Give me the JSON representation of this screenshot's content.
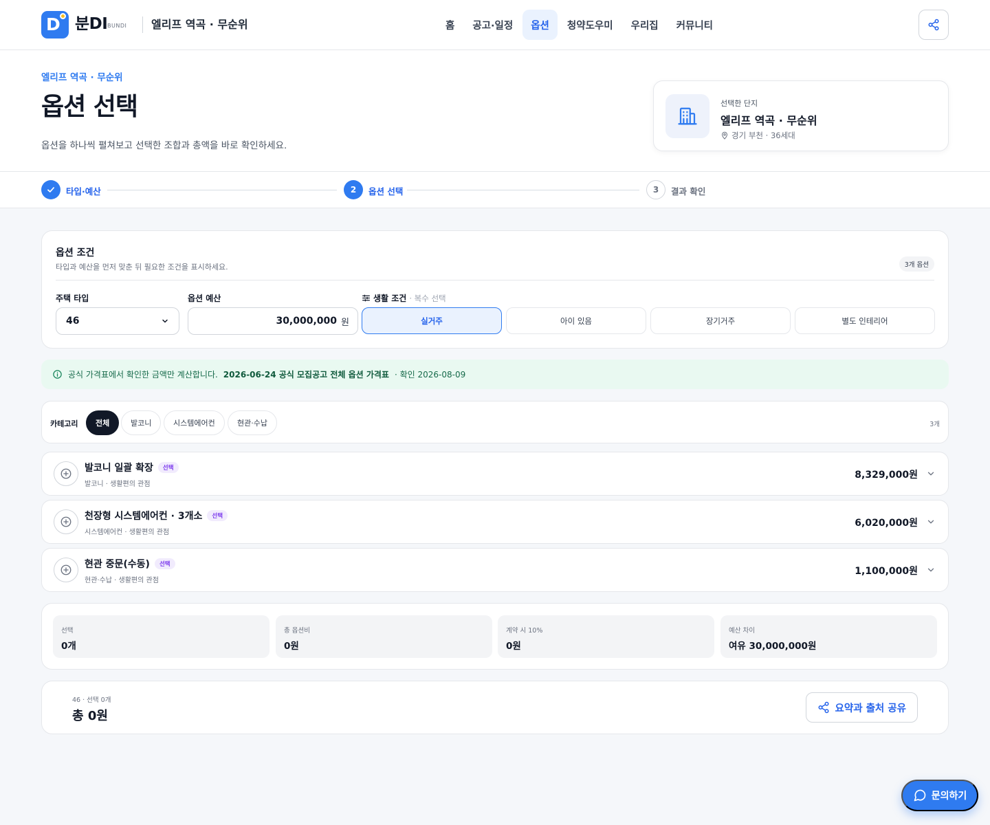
{
  "header": {
    "brand": "분DI",
    "brand_sub": "BUNDI",
    "site_name": "엘리프 역곡 · 무순위",
    "nav": [
      {
        "label": "홈",
        "active": false
      },
      {
        "label": "공고·일정",
        "active": false
      },
      {
        "label": "옵션",
        "active": true
      },
      {
        "label": "청약도우미",
        "active": false
      },
      {
        "label": "우리집",
        "active": false
      },
      {
        "label": "커뮤니티",
        "active": false
      }
    ]
  },
  "hero": {
    "eyebrow": "엘리프 역곡 · 무순위",
    "title": "옵션 선택",
    "description": "옵션을 하나씩 펼쳐보고 선택한 조합과 총액을 바로 확인하세요.",
    "complex_card": {
      "label": "선택한 단지",
      "name": "엘리프 역곡 · 무순위",
      "meta": "경기 부천 · 36세대"
    }
  },
  "stepper": {
    "steps": [
      {
        "number": "1",
        "label": "타입·예산",
        "state": "done"
      },
      {
        "number": "2",
        "label": "옵션 선택",
        "state": "current"
      },
      {
        "number": "3",
        "label": "결과 확인",
        "state": "todo"
      }
    ]
  },
  "conditions": {
    "title": "옵션 조건",
    "subtitle": "타입과 예산을 먼저 맞춘 뒤 필요한 조건을 표시하세요.",
    "option_count": "3개 옵션",
    "type_label": "주택 타입",
    "type_value": "46",
    "budget_label": "옵션 예산",
    "budget_value": "30,000,000",
    "budget_unit": "원",
    "life_label": "생활 조건",
    "life_hint": "· 복수 선택",
    "chips": [
      {
        "label": "실거주",
        "selected": true
      },
      {
        "label": "아이 있음",
        "selected": false
      },
      {
        "label": "장기거주",
        "selected": false
      },
      {
        "label": "별도 인테리어",
        "selected": false
      }
    ]
  },
  "notice": {
    "prefix": "공식 가격표에서 확인한 금액만 계산합니다.",
    "source": "2026-06-24 공식 모집공고 전체 옵션 가격표",
    "checked": "· 확인 2026-08-09"
  },
  "categories": {
    "label": "카테고리",
    "items": [
      {
        "label": "전체",
        "active": true
      },
      {
        "label": "발코니",
        "active": false
      },
      {
        "label": "시스템에어컨",
        "active": false
      },
      {
        "label": "현관·수납",
        "active": false
      }
    ],
    "count": "3개"
  },
  "options": [
    {
      "name": "발코니 일괄 확장",
      "badge": "선택",
      "meta": "발코니 · 생활편의 관점",
      "price": "8,329,000원"
    },
    {
      "name": "천장형 시스템에어컨 · 3개소",
      "badge": "선택",
      "meta": "시스템에어컨 · 생활편의 관점",
      "price": "6,020,000원"
    },
    {
      "name": "현관 중문(수동)",
      "badge": "선택",
      "meta": "현관·수납 · 생활편의 관점",
      "price": "1,100,000원"
    }
  ],
  "summary": [
    {
      "label": "선택",
      "value": "0개"
    },
    {
      "label": "총 옵션비",
      "value": "0원"
    },
    {
      "label": "계약 시 10%",
      "value": "0원"
    },
    {
      "label": "예산 차이",
      "value": "여유 30,000,000원"
    }
  ],
  "footer": {
    "meta": "46 · 선택 0개",
    "total": "총 0원",
    "share_label": "요약과 출처 공유"
  },
  "inquiry_label": "문의하기",
  "colors": {
    "accent": "#2f7bf0",
    "notice_bg": "#e9f9f1",
    "badge_purple": "#7c3aed"
  },
  "icons": [
    "share-icon",
    "building-icon",
    "location-pin-icon",
    "check-icon",
    "filter-icon",
    "info-icon",
    "plus-circle-icon",
    "chevron-down-icon",
    "chat-bubble-icon"
  ]
}
